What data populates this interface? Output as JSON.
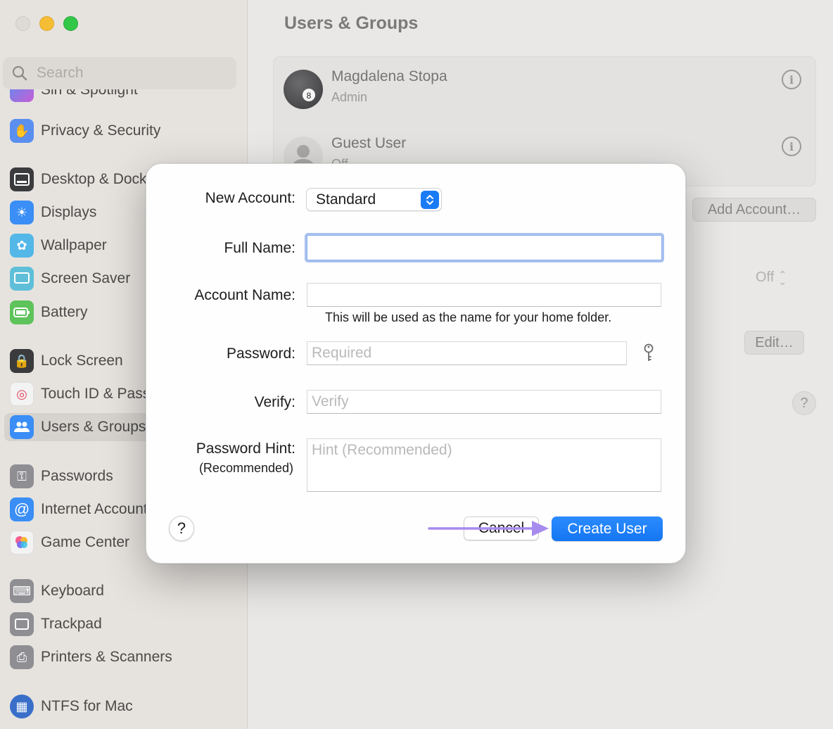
{
  "sidebar": {
    "search_placeholder": "Search",
    "items": [
      {
        "label": "Siri & Spotlight",
        "icon": "siri-icon"
      },
      {
        "label": "Privacy & Security",
        "icon": "hand-icon"
      },
      {
        "label": "Desktop & Dock",
        "icon": "dock-icon"
      },
      {
        "label": "Displays",
        "icon": "sun-icon"
      },
      {
        "label": "Wallpaper",
        "icon": "flower-icon"
      },
      {
        "label": "Screen Saver",
        "icon": "screen-saver-icon"
      },
      {
        "label": "Battery",
        "icon": "battery-icon"
      },
      {
        "label": "Lock Screen",
        "icon": "lock-icon"
      },
      {
        "label": "Touch ID & Password",
        "icon": "fingerprint-icon"
      },
      {
        "label": "Users & Groups",
        "icon": "users-icon",
        "selected": true
      },
      {
        "label": "Passwords",
        "icon": "key-icon"
      },
      {
        "label": "Internet Accounts",
        "icon": "at-icon"
      },
      {
        "label": "Game Center",
        "icon": "game-center-icon"
      },
      {
        "label": "Keyboard",
        "icon": "keyboard-icon"
      },
      {
        "label": "Trackpad",
        "icon": "trackpad-icon"
      },
      {
        "label": "Printers & Scanners",
        "icon": "printer-icon"
      },
      {
        "label": "NTFS for Mac",
        "icon": "ntfs-icon"
      }
    ]
  },
  "main": {
    "title": "Users & Groups",
    "users": [
      {
        "name": "Magdalena Stopa",
        "role": "Admin"
      },
      {
        "name": "Guest User",
        "role": "Off"
      }
    ],
    "add_account_label": "Add Account…",
    "auto_login_value": "Off",
    "edit_label": "Edit…",
    "help_label": "?"
  },
  "dialog": {
    "new_account_label": "New Account:",
    "account_type": "Standard",
    "full_name_label": "Full Name:",
    "full_name_value": "",
    "account_name_label": "Account Name:",
    "account_name_value": "",
    "account_name_note": "This will be used as the name for your home folder.",
    "password_label": "Password:",
    "password_placeholder": "Required",
    "verify_label": "Verify:",
    "verify_placeholder": "Verify",
    "hint_label": "Password Hint:",
    "hint_sublabel": "(Recommended)",
    "hint_placeholder": "Hint (Recommended)",
    "help_label": "?",
    "cancel_label": "Cancel",
    "create_label": "Create User"
  },
  "colors": {
    "accent": "#1a7cf5",
    "annotation_arrow": "#a78bef"
  }
}
